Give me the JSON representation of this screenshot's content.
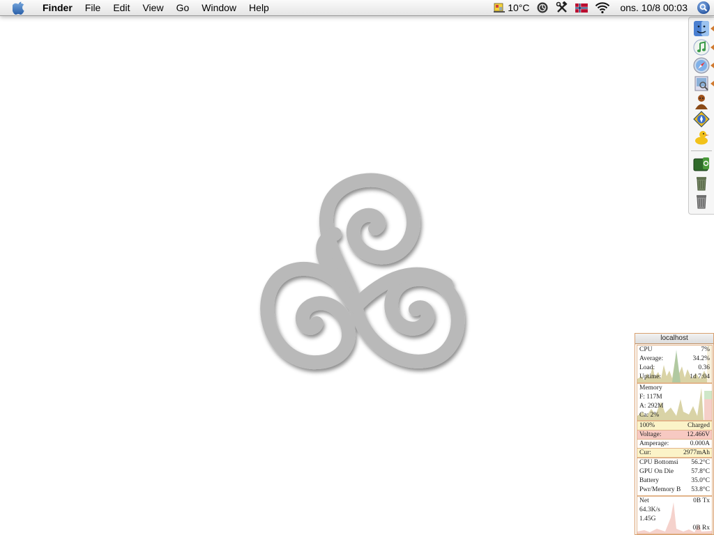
{
  "menubar": {
    "app_name": "Finder",
    "menus": [
      "File",
      "Edit",
      "View",
      "Go",
      "Window",
      "Help"
    ],
    "temperature": "10°C",
    "clock": "ons. 10/8  00:03",
    "icons": [
      "apple-icon",
      "weather-icon",
      "status-circle-icon",
      "tools-icon",
      "norway-flag-icon",
      "wifi-icon",
      "spotlight-icon"
    ]
  },
  "dock": {
    "icons": [
      "finder-icon",
      "itunes-icon",
      "safari-icon",
      "preview-icon",
      "character-icon",
      "compass-icon",
      "duck-icon",
      "external-drive-icon",
      "trash-full-icon",
      "trash-icon"
    ],
    "running_indicator_color": "#d07a30"
  },
  "monitor": {
    "title": "localhost",
    "cpu": {
      "label": "CPU",
      "value": "7%",
      "avg_label": "Average:",
      "avg": "34.2%",
      "load_label": "Load:",
      "load": "0.36",
      "uptime_label": "Uptime:",
      "uptime": "1d 7:04"
    },
    "memory": {
      "label": "Memory",
      "free": "F: 117M",
      "active": "A: 292M",
      "cache": "Ca: 2%"
    },
    "battery": {
      "level": "100%",
      "state": "Charged",
      "voltage_label": "Voltage:",
      "voltage": "12.466V",
      "amperage_label": "Amperage:",
      "amperage": "0.000A",
      "cur_label": "Cur:",
      "cur": "2977mAh"
    },
    "temps": [
      {
        "label": "CPU Bottomsi",
        "value": "56.2°C"
      },
      {
        "label": "GPU On Die",
        "value": "57.8°C"
      },
      {
        "label": "Battery",
        "value": "35.0°C"
      },
      {
        "label": "Pwr/Memory B",
        "value": "53.8°C"
      }
    ],
    "net": {
      "label": "Net",
      "tx": "0B Tx",
      "rate": "64.3K/s",
      "total": "1.45G",
      "rx": "0B Rx"
    }
  }
}
